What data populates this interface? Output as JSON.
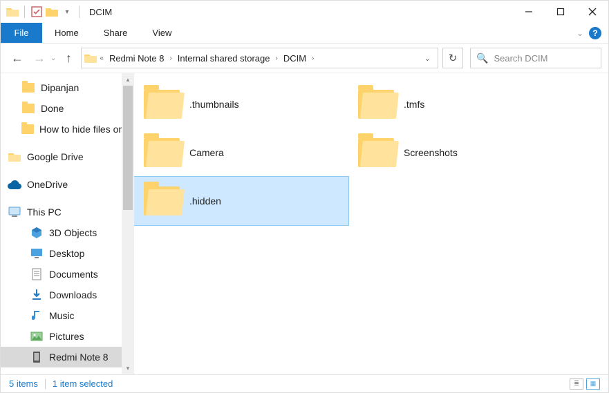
{
  "window_title": "DCIM",
  "ribbon": {
    "file": "File",
    "home": "Home",
    "share": "Share",
    "view": "View"
  },
  "breadcrumbs": [
    "Redmi Note 8",
    "Internal shared storage",
    "DCIM"
  ],
  "search_placeholder": "Search DCIM",
  "sidebar": {
    "items": [
      {
        "label": "Dipanjan",
        "icon": "folder",
        "indent": "indent"
      },
      {
        "label": "Done",
        "icon": "folder",
        "indent": "indent"
      },
      {
        "label": "How to hide files on...",
        "icon": "folder",
        "indent": "indent"
      },
      {
        "label": "Google Drive",
        "icon": "gdrive",
        "indent": ""
      },
      {
        "label": "OneDrive",
        "icon": "onedrive",
        "indent": ""
      },
      {
        "label": "This PC",
        "icon": "thispc",
        "indent": ""
      },
      {
        "label": "3D Objects",
        "icon": "3d",
        "indent": "indent2"
      },
      {
        "label": "Desktop",
        "icon": "desktop",
        "indent": "indent2"
      },
      {
        "label": "Documents",
        "icon": "documents",
        "indent": "indent2"
      },
      {
        "label": "Downloads",
        "icon": "downloads",
        "indent": "indent2"
      },
      {
        "label": "Music",
        "icon": "music",
        "indent": "indent2"
      },
      {
        "label": "Pictures",
        "icon": "pictures",
        "indent": "indent2"
      },
      {
        "label": "Redmi Note 8",
        "icon": "phone",
        "indent": "indent2",
        "selected": true
      }
    ]
  },
  "folders": [
    {
      "name": ".thumbnails",
      "selected": false
    },
    {
      "name": ".tmfs",
      "selected": false
    },
    {
      "name": "Camera",
      "selected": false
    },
    {
      "name": "Screenshots",
      "selected": false
    },
    {
      "name": ".hidden",
      "selected": true
    }
  ],
  "status": {
    "count": "5 items",
    "selection": "1 item selected"
  }
}
